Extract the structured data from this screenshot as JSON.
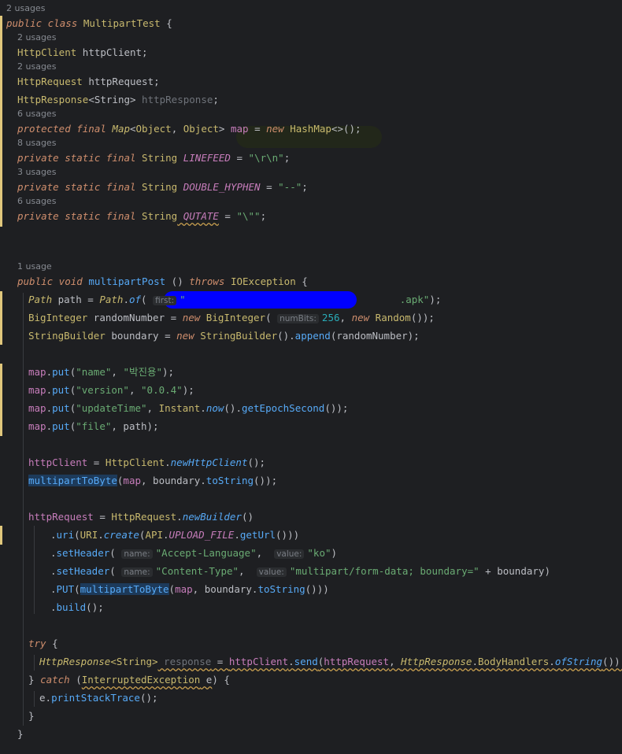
{
  "usages": {
    "class": "2 usages",
    "httpClient": "2 usages",
    "httpRequest": "2 usages",
    "map": "6 usages",
    "linefeed": "8 usages",
    "doubleHyphen": "3 usages",
    "qutate": "6 usages",
    "method": "1 usage"
  },
  "code": {
    "class_decl": [
      "public",
      " class",
      " MultipartTest",
      " {"
    ],
    "f1": [
      "HttpClient",
      " httpClient;"
    ],
    "f2": [
      "HttpRequest",
      " httpRequest;"
    ],
    "f3": [
      "HttpResponse",
      "<String>",
      " httpResponse",
      ";"
    ],
    "f4": [
      "protected",
      " final",
      " Map",
      "<",
      "Object",
      ", ",
      "Object",
      ">",
      " map",
      " = ",
      "new",
      " HashMap",
      "<>();"
    ],
    "f5": [
      "private",
      " static",
      " final",
      " String",
      " LINEFEED",
      " = ",
      "\"\\r\\n\"",
      ";"
    ],
    "f6": [
      "private",
      " static",
      " final",
      " String",
      " DOUBLE_HYPHEN",
      " = ",
      "\"--\"",
      ";"
    ],
    "f7": [
      "private",
      " static",
      " final",
      " String",
      " QUTATE",
      " = ",
      "\"\\\"\"",
      ";"
    ],
    "m_decl": [
      "public",
      " void",
      " multipartPost",
      " () ",
      "throws",
      " IOException",
      " {"
    ],
    "l1": [
      "Path",
      " path = ",
      "Path",
      ".",
      "of",
      "(",
      "first:",
      "\"",
      ".apk\"",
      ");"
    ],
    "l2": [
      "BigInteger",
      " randomNumber = ",
      "new",
      " BigInteger",
      "(",
      "numBits:",
      "256",
      ", ",
      "new",
      " Random",
      "());"
    ],
    "l3": [
      "StringBuilder",
      " boundary = ",
      "new",
      " StringBuilder",
      "().",
      "append",
      "(randomNumber);"
    ],
    "l4": [
      "map",
      ".",
      "put",
      "(",
      "\"name\"",
      ", ",
      "\"박진용\"",
      ");"
    ],
    "l5": [
      "map",
      ".",
      "put",
      "(",
      "\"version\"",
      ", ",
      "\"0.0.4\"",
      ");"
    ],
    "l6": [
      "map",
      ".",
      "put",
      "(",
      "\"updateTime\"",
      ", ",
      "Instant",
      ".",
      "now",
      "().",
      "getEpochSecond",
      "());"
    ],
    "l7": [
      "map",
      ".",
      "put",
      "(",
      "\"file\"",
      ", path);"
    ],
    "l8": [
      "httpClient",
      " = ",
      "HttpClient",
      ".",
      "newHttpClient",
      "();"
    ],
    "l9": [
      "multipartToByte",
      "(",
      "map",
      ", boundary.",
      "toString",
      "());"
    ],
    "l10": [
      "httpRequest",
      " = ",
      "HttpRequest",
      ".",
      "newBuilder",
      "()"
    ],
    "l11": [
      ".",
      "uri",
      "(",
      "URI",
      ".",
      "create",
      "(",
      "API",
      ".",
      "UPLOAD_FILE",
      ".",
      "getUrl",
      "()))"
    ],
    "l12": [
      ".",
      "setHeader",
      "(",
      "name:",
      "\"Accept-Language\"",
      ", ",
      "value:",
      "\"ko\"",
      ")"
    ],
    "l13": [
      ".",
      "setHeader",
      "(",
      "name:",
      "\"Content-Type\"",
      ", ",
      "value:",
      "\"multipart/form-data; boundary=\"",
      " + boundary)"
    ],
    "l14": [
      ".",
      "PUT",
      "(",
      "multipartToByte",
      "(",
      "map",
      ", boundary.",
      "toString",
      "()))"
    ],
    "l15": [
      ".",
      "build",
      "();"
    ],
    "l16": [
      "try",
      " {"
    ],
    "l17": [
      "HttpResponse",
      "<String>",
      " response",
      " = ",
      "httpClient",
      ".",
      "send",
      "(",
      "httpRequest",
      ", ",
      "HttpResponse",
      ".",
      "BodyHandlers",
      ".",
      "ofString",
      "());"
    ],
    "l18": [
      "} ",
      "catch",
      " (",
      "InterruptedException",
      " e",
      ") {"
    ],
    "l19": [
      "e.",
      "printStackTrace",
      "();"
    ],
    "l20": [
      "}"
    ],
    "l21": [
      "}"
    ]
  }
}
